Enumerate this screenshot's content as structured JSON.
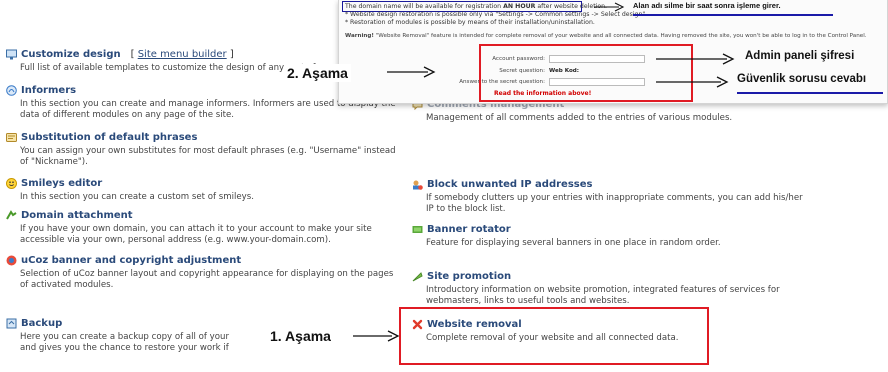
{
  "left_items": [
    {
      "title": "Customize design",
      "extra_text": "Site menu builder",
      "desc": "Full list of available templates to customize the design of any part of your website.",
      "icon": "monitor-icon"
    },
    {
      "title": "Informers",
      "desc": "In this section you can create and manage informers. Informers are used to display the data of different modules on any page of the site.",
      "icon": "informer-icon"
    },
    {
      "title": "Substitution of default phrases",
      "desc": "You can assign your own substitutes for most default phrases (e.g. \"Username\" instead of \"Nickname\").",
      "icon": "phrases-icon"
    },
    {
      "title": "Smileys editor",
      "desc": "In this section you can create a custom set of smileys.",
      "icon": "smiley-icon"
    },
    {
      "title": "Domain attachment",
      "desc": "If you have your own domain, you can attach it to your account to make your site accessible via your own, personal address (e.g. www.your-domain.com).",
      "icon": "domain-icon"
    },
    {
      "title": "uCoz banner and copyright adjustment",
      "desc": "Selection of uCoz banner layout and copyright appearance for displaying on the pages of activated modules.",
      "icon": "banner-icon"
    },
    {
      "title": "Backup",
      "desc": "Here you can create a backup copy of all of your data and gives you the chance to restore your work if",
      "icon": "backup-icon"
    }
  ],
  "right_items": [
    {
      "title": "Comments management",
      "desc": "Management of all comments added to the entries of various modules.",
      "icon": "comments-icon"
    },
    {
      "title": "Block unwanted IP addresses",
      "desc": "If somebody clutters up your entries with inappropriate comments, you can add his/her IP to the block list.",
      "icon": "block-ip-icon"
    },
    {
      "title": "Banner rotator",
      "desc": "Feature for displaying several banners in one place in random order.",
      "icon": "banner-rotator-icon"
    },
    {
      "title": "Site promotion",
      "desc": "Introductory information on website promotion, integrated features of services for webmasters, links to useful tools and websites.",
      "icon": "promotion-icon"
    },
    {
      "title": "Website removal",
      "desc": "Complete removal of your website and all connected data.",
      "icon": "remove-x-icon"
    }
  ],
  "overlay": {
    "line1_pre": "The domain name will be available for registration ",
    "line1_bold": "AN HOUR",
    "line1_post": " after website deletion.",
    "line2": "* Website design restoration is possible only via \"Settings -> Common settings -> Select design\".",
    "line3": "* Restoration of modules is possible by means of their installation/uninstallation.",
    "warning_bold": "Warning!",
    "warning_text": " \"Website Removal\" feature is intended for complete removal of your website and all connected data. Having removed the site, you won't be able to log in to the Control Panel.",
    "form": {
      "password_label": "Account password:",
      "question_label": "Secret question:",
      "question_value": "Web Kod:",
      "answer_label": "Answer to the secret question:",
      "read_note": "Read the information above!"
    }
  },
  "annotations": {
    "domain_note": "Alan adı silme bir saat sonra işleme girer.",
    "admin_password": "Admin paneli şifresi",
    "security_answer": "Güvenlik sorusu cevabı",
    "step1": "1. Aşama",
    "step2": "2. Aşama"
  },
  "colors": {
    "title": "#2a4a7a",
    "red_box": "#e01b24",
    "blue_box": "#1a1a9a",
    "warning_red": "#d10000"
  }
}
